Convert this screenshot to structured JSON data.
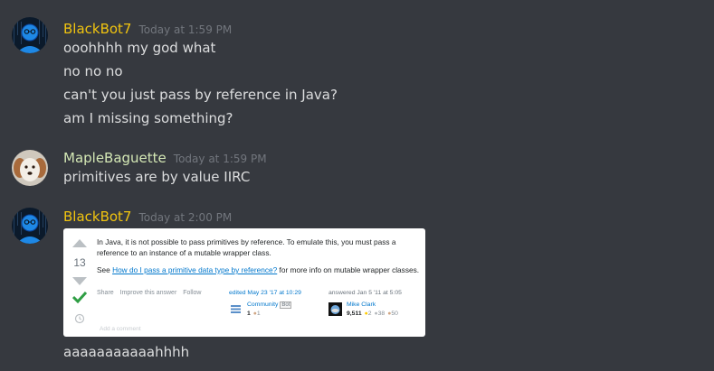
{
  "colors": {
    "background": "#36393f",
    "blackbot_name": "#f1c40f",
    "maple_name": "#d4e8b5",
    "message_text": "#dcddde",
    "timestamp": "#72767d"
  },
  "messages": [
    {
      "author": "BlackBot7",
      "timestamp": "Today at 1:59 PM",
      "lines": [
        "ooohhhh my god what",
        "no no no",
        "can't you just pass by reference in Java?",
        "am I missing something?"
      ]
    },
    {
      "author": "MapleBaguette",
      "timestamp": "Today at 1:59 PM",
      "lines": [
        "primitives are by value IIRC"
      ]
    },
    {
      "author": "BlackBot7",
      "timestamp": "Today at 2:00 PM",
      "lines": [
        "aaaaaaaaaaahhhh"
      ]
    }
  ],
  "embed": {
    "vote_count": "13",
    "paragraph1": "In Java, it is not possible to pass primitives by reference. To emulate this, you must pass a reference to an instance of a mutable wrapper class.",
    "paragraph2_prefix": "See ",
    "paragraph2_link": "How do I pass a primitive data type by reference?",
    "paragraph2_suffix": " for more info on mutable wrapper classes.",
    "post_menu": [
      "Share",
      "Improve this answer",
      "Follow"
    ],
    "edit_label": "edited May 23 '17 at 10:29",
    "editor_name": "Community",
    "editor_badge": "Bot",
    "editor_rep": "1",
    "editor_badge_count": "1",
    "answer_label": "answered Jan 5 '11 at 5:05",
    "answerer_name": "Mike Clark",
    "answerer_rep": "9,511",
    "gold_count": "2",
    "silver_count": "38",
    "bronze_count": "50",
    "add_comment": "Add a comment"
  }
}
